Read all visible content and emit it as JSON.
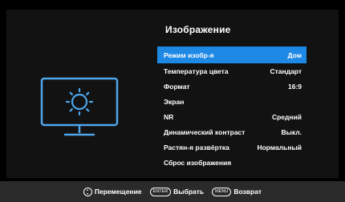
{
  "menu": {
    "title": "Изображение",
    "items": [
      {
        "label": "Режим изобр-я",
        "value": "Дом",
        "selected": true
      },
      {
        "label": "Температура цвета",
        "value": "Стандарт"
      },
      {
        "label": "Формат",
        "value": "16:9"
      },
      {
        "label": "Экран",
        "value": ""
      },
      {
        "label": "NR",
        "value": "Средний"
      },
      {
        "label": "Динамический контраст",
        "value": "Выкл."
      },
      {
        "label": "Растян-я развёртка",
        "value": "Нормальный"
      },
      {
        "label": "Сброс изображения",
        "value": ""
      }
    ]
  },
  "icon": {
    "name": "monitor-brightness-icon",
    "color": "#4ea6ec"
  },
  "colors": {
    "accent": "#1e88e5",
    "panel": "#121212",
    "footer": "#2a2a2a"
  },
  "footer": {
    "move_label": "Перемещение",
    "enter_key": "ENTER",
    "select_label": "Выбрать",
    "menu_key": "MENU",
    "back_label": "Возврат"
  }
}
